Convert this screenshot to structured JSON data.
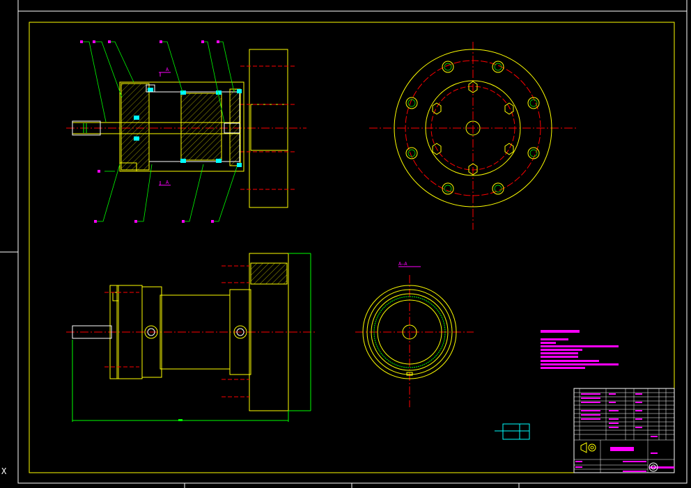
{
  "colors": {
    "background": "#000000",
    "sheet_border": "#ffffff",
    "frame": "#ffff00",
    "center_line": "#ff0000",
    "leader": "#00ff00",
    "annotation": "#ff00ff",
    "seal": "#00ffff",
    "detail": "#ffffff"
  },
  "section_marker": "A",
  "view_label": "A—A",
  "crosshair_glyph": "X"
}
